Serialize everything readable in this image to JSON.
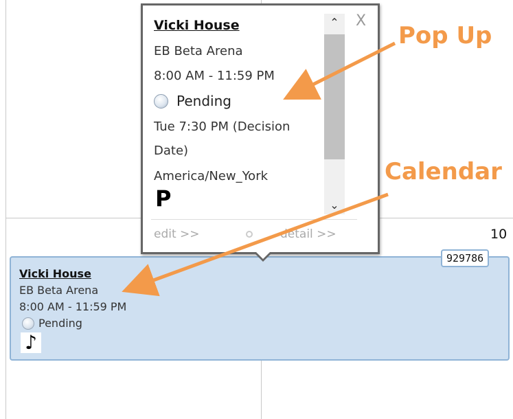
{
  "calendar": {
    "day_number": "10",
    "event": {
      "title": "Vicki House",
      "location": "EB Beta Arena",
      "time": "8:00 AM - 11:59 PM",
      "status": "Pending",
      "id_badge": "929786",
      "icon": "music-note-icon"
    }
  },
  "popup": {
    "title": "Vicki House",
    "location": "EB Beta Arena",
    "time": "8:00 AM - 11:59 PM",
    "status": "Pending",
    "decision_line1": "Tue 7:30 PM (Decision",
    "decision_line2": "Date)",
    "timezone": "America/New_York",
    "badge_letter": "P",
    "close_label": "X",
    "edit_link": "edit >>",
    "detail_link": "detail >>"
  },
  "annotations": {
    "popup_label": "Pop Up",
    "calendar_label": "Calendar",
    "color": "#f39a4a"
  }
}
